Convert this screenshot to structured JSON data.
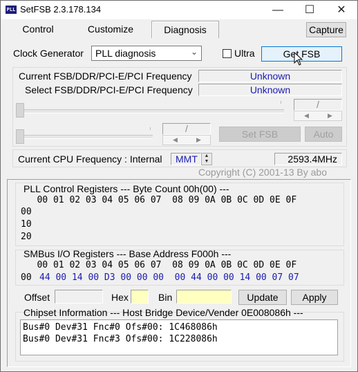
{
  "window": {
    "title": "SetFSB 2.3.178.134"
  },
  "icons": {
    "app": "pll-icon",
    "minimize": "minimize-icon",
    "maximize": "maximize-icon",
    "close": "close-icon"
  },
  "tabs": [
    {
      "label": "Control"
    },
    {
      "label": "Customize"
    },
    {
      "label": "Diagnosis",
      "active": true
    }
  ],
  "capture_label": "Capture",
  "clock": {
    "label": "Clock Generator",
    "selected": "PLL diagnosis",
    "ultra_label": "Ultra",
    "ultra_checked": false,
    "get_fsb_label": "Get FSB"
  },
  "freq": {
    "current_label": "Current FSB/DDR/PCI-E/PCI Frequency",
    "current_value": "Unknown",
    "select_label": "Select FSB/DDR/PCI-E/PCI Frequency",
    "select_value": "Unknown",
    "slider1_readout": "/",
    "slider2_readout": "/",
    "set_fsb_label": "Set FSB",
    "auto_label": "Auto"
  },
  "cpu": {
    "label": "Current CPU Frequency : Internal",
    "mode": "MMT",
    "value": "2593.4MHz"
  },
  "copyright": "Copyright (C) 2001-13 By abo",
  "pll": {
    "header": "PLL Control Registers  --- Byte Count 00h(00) ---",
    "columns": "   00 01 02 03 04 05 06 07  08 09 0A 0B 0C 0D 0E 0F",
    "rows": [
      "00",
      "10",
      "20"
    ]
  },
  "smbus": {
    "header": "SMBus I/O Registers  --- Base Address F000h ---",
    "columns": "   00 01 02 03 04 05 06 07  08 09 0A 0B 0C 0D 0E 0F",
    "row_addr": "00",
    "row_values": "44 00 14 00 D3 00 00 00  00 44 00 00 14 00 07 07"
  },
  "controls": {
    "offset_label": "Offset",
    "hex_label": "Hex",
    "bin_label": "Bin",
    "update_label": "Update",
    "apply_label": "Apply"
  },
  "chipset": {
    "header": "Chipset Information  --- Host Bridge Device/Vender 0E008086h ---",
    "lines": [
      "Bus#0 Dev#31 Fnc#0 Ofs#00: 1C468086h",
      "Bus#0 Dev#31 Fnc#3 Ofs#00: 1C228086h"
    ]
  },
  "colors": {
    "value_blue": "#1b1bb0",
    "accent": "#0078d7",
    "highlight_yellow": "#ffffc0"
  }
}
